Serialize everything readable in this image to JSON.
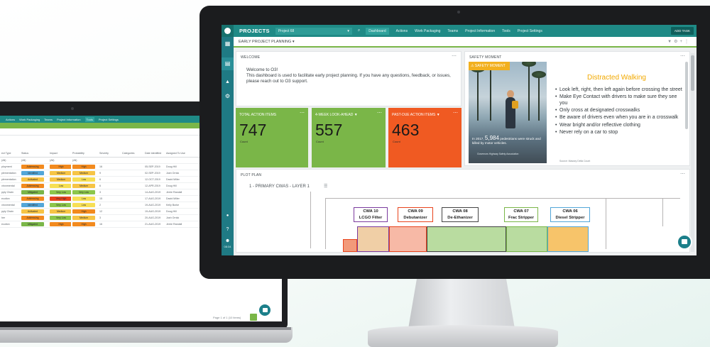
{
  "laptop": {
    "nav_items": [
      "Actions",
      "Work Packaging",
      "Teams",
      "Project Information",
      "Tools",
      "Project Settings"
    ],
    "active_nav": "Tools",
    "table": {
      "headers": [
        "ect Type",
        "Status",
        "Impact",
        "Probability",
        "Severity",
        "Categories",
        "Date Identified",
        "Assigned To Use"
      ],
      "filters": [
        "(All)",
        "(All)",
        "(All)",
        "(All)",
        "",
        "",
        "",
        ""
      ],
      "rows": [
        {
          "type": "ployment",
          "status": "Addressing",
          "impact": "High",
          "prob": "High",
          "sev": "16",
          "date": "05-SEP-2019",
          "user": "Doug Hill"
        },
        {
          "type": "plementation",
          "status": "Identified",
          "impact": "Medium",
          "prob": "Medium",
          "sev": "9",
          "date": "02-SEP-2019",
          "user": "Josh Orrick"
        },
        {
          "type": "plementation",
          "status": "Activated",
          "impact": "Medium",
          "prob": "Low",
          "sev": "6",
          "date": "12-OCT-2019",
          "user": "David Miller"
        },
        {
          "type": "vironmental",
          "status": "Addressing",
          "impact": "Low",
          "prob": "Medium",
          "sev": "6",
          "date": "12-APR-2019",
          "user": "Doug Hill"
        },
        {
          "type": "pply Chain",
          "status": "Mitigated",
          "impact": "Very Low",
          "prob": "Very Low",
          "sev": "3",
          "date": "14-AUG-2019",
          "user": "Jerrie Randall"
        },
        {
          "type": "ecution",
          "status": "Addressing",
          "impact": "Very High",
          "prob": "Low",
          "sev": "15",
          "date": "17-AUG-2019",
          "user": "David Miller"
        },
        {
          "type": "vironmental",
          "status": "Identified",
          "impact": "Very Low",
          "prob": "Low",
          "sev": "2",
          "date": "19-AUG-2019",
          "user": "Kelly Burke"
        },
        {
          "type": "pply Chain",
          "status": "Activated",
          "impact": "Medium",
          "prob": "High",
          "sev": "12",
          "date": "19-AUG-2019",
          "user": "Doug Hill"
        },
        {
          "type": "her",
          "status": "Addressing",
          "impact": "Very Low",
          "prob": "Medium",
          "sev": "3",
          "date": "20-AUG-2019",
          "user": "Josh Orrick"
        },
        {
          "type": "ecution",
          "status": "Mitigated",
          "impact": "High",
          "prob": "High",
          "sev": "16",
          "date": "21-AUG-2019",
          "user": "Jerrie Randall"
        }
      ]
    },
    "pager": "Page 1 of 1 (10 items)",
    "colors": {
      "Addressing": "#f28a1e",
      "Identified": "#52a6d8",
      "Activated": "#f6c445",
      "Mitigated": "#7ab648",
      "High": "#f28a1e",
      "Medium": "#f6c445",
      "Low": "#f6df55",
      "Very Low": "#8cc64b",
      "Very High": "#e8431c"
    }
  },
  "nav": {
    "title": "PROJECTS",
    "project": "Project 68",
    "items": [
      "Dashboard",
      "Actions",
      "Work Packaging",
      "Teams",
      "Project Information",
      "Tools",
      "Project Settings"
    ],
    "active": "Dashboard",
    "add_task": "ADD TASK"
  },
  "rail": {
    "time": "08:34"
  },
  "dashboard": {
    "title": "EARLY PROJECT PLANNING",
    "welcome": {
      "title": "WELCOME",
      "line1": "Welcome to O3!",
      "body": "This dashboard is used to facilitate early project planning. If you have any questions, feedback, or issues, please reach out to O3 support."
    },
    "kpis": [
      {
        "label": "TOTAL ACTION ITEMS",
        "value": "747",
        "sub": "Count",
        "color": "#7ab648"
      },
      {
        "label": "4-WEEK LOOK-AHEAD",
        "value": "557",
        "sub": "Count",
        "color": "#7ab648"
      },
      {
        "label": "PAST-DUE ACTION ITEMS",
        "value": "463",
        "sub": "Count",
        "color": "#f05a22"
      }
    ],
    "safety": {
      "title": "SAFETY MOMENT",
      "badge": "SAFETY MOMENT",
      "heading": "Distracted Walking",
      "stat_prefix": "In 2017,",
      "stat_number": "5,984",
      "stat_suffix": "pedestrians were struck and killed by motor vehicles.",
      "caption": "Governors Highway Safety Association",
      "items": [
        "Look left, right, then left again before crossing the street",
        "Make Eye Contact with drivers to make sure they see you",
        "Only cross at designated crosswalks",
        "Be aware of drivers even when you are in a crosswalk",
        "Wear bright and/or reflective clothing",
        "Never rely on a car to stop"
      ],
      "source": "Source: Massey Delta Count"
    },
    "plot": {
      "title": "PLOT PLAN",
      "subtitle": "1 - PRIMARY CWAS - LAYER 1",
      "cwas": [
        {
          "code": "CWA 10",
          "name": "LCGO Filter",
          "color": "#7b3a9e",
          "fill": "#f0cfa6"
        },
        {
          "code": "CWA 09",
          "name": "Debutanizer",
          "color": "#e8431c",
          "fill": "#f7b9a6"
        },
        {
          "code": "CWA 08",
          "name": "De-Ethanizer",
          "color": "#444444",
          "fill": "#b9dca0"
        },
        {
          "code": "CWA 07",
          "name": "Frac Stripper",
          "color": "#7ab648",
          "fill": "#b9dca0"
        },
        {
          "code": "CWA 06",
          "name": "Diesel Stripper",
          "color": "#52a6d8",
          "fill": "#f7c46a"
        }
      ]
    }
  }
}
